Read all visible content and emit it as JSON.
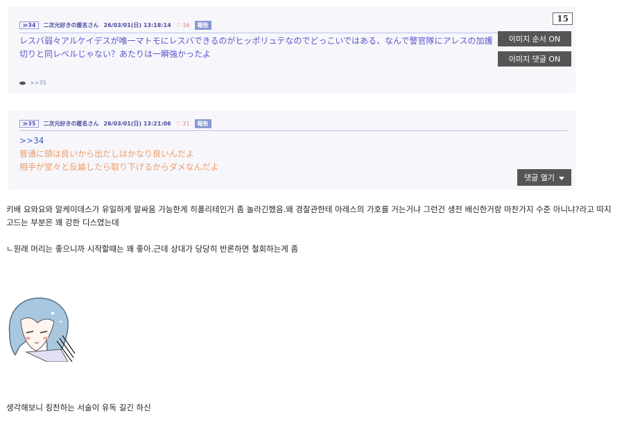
{
  "screenshot1": {
    "res_no": "≫34",
    "poster": "二次元好きの匿名さん",
    "datetime": "26/03/01(日) 13:18:14",
    "likes": "♡ 16",
    "report": "報告",
    "counter": "15",
    "lines": [
      "レスバ弱々アルケイデスが唯一マトモにレスバできるのがヒッポリュテなのでどっこいではある、なんで警官隊にアレスの加護",
      "切りと同レベルじゃない？あたりは一瞬強かったよ"
    ],
    "overlay_buttons": [
      "이미지 순서 ON",
      "이미지 댓글 ON"
    ],
    "footer_link": ">>35"
  },
  "screenshot2": {
    "res_no": "≫35",
    "poster": "二次元好きの匿名さん",
    "datetime": "26/03/01(日) 13:21:06",
    "likes": "♡ 31",
    "report": "報告",
    "quote": ">>34",
    "lines": [
      "普通に頭は良いから出だしはかなり良いんだよ",
      "相手が堂々と反論したら取り下げるからダメなんだよ"
    ],
    "open_comments": "댓글 열기"
  },
  "paragraphs": {
    "p1": "키배 요와요와 알케이데스가 유일하게 말싸움 가능한게 히폴리테인거 좀 놀라긴했음.왜 경찰관한테 아레스의 가호를 거는거냐 그런건 생전 배신한거랑 마찬가지 수준 아니냐?라고 따지고드는 부분은 꽤 강한 디스였는데",
    "p2": "ㄴ원래 머리는 좋으니까 시작할때는 꽤 좋아.근데 상대가 당당히 반론하면 철회하는게 좀",
    "p3": "생각해보니 칭찬하는 서술이 유독 길긴 하신"
  },
  "colors": {
    "post_text_blue": "#5a55cc",
    "post_text_orange": "#ee9a66",
    "overlay_button": "#555555"
  }
}
